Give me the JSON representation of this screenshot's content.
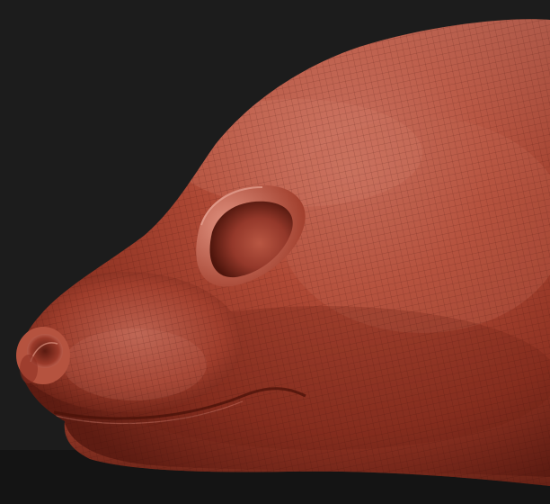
{
  "viewport": {
    "background_color": "#1c1c1c",
    "material_color": "#a8402e",
    "highlight_color": "#d98878",
    "shadow_color": "#5a1a10",
    "wireframe": true
  }
}
